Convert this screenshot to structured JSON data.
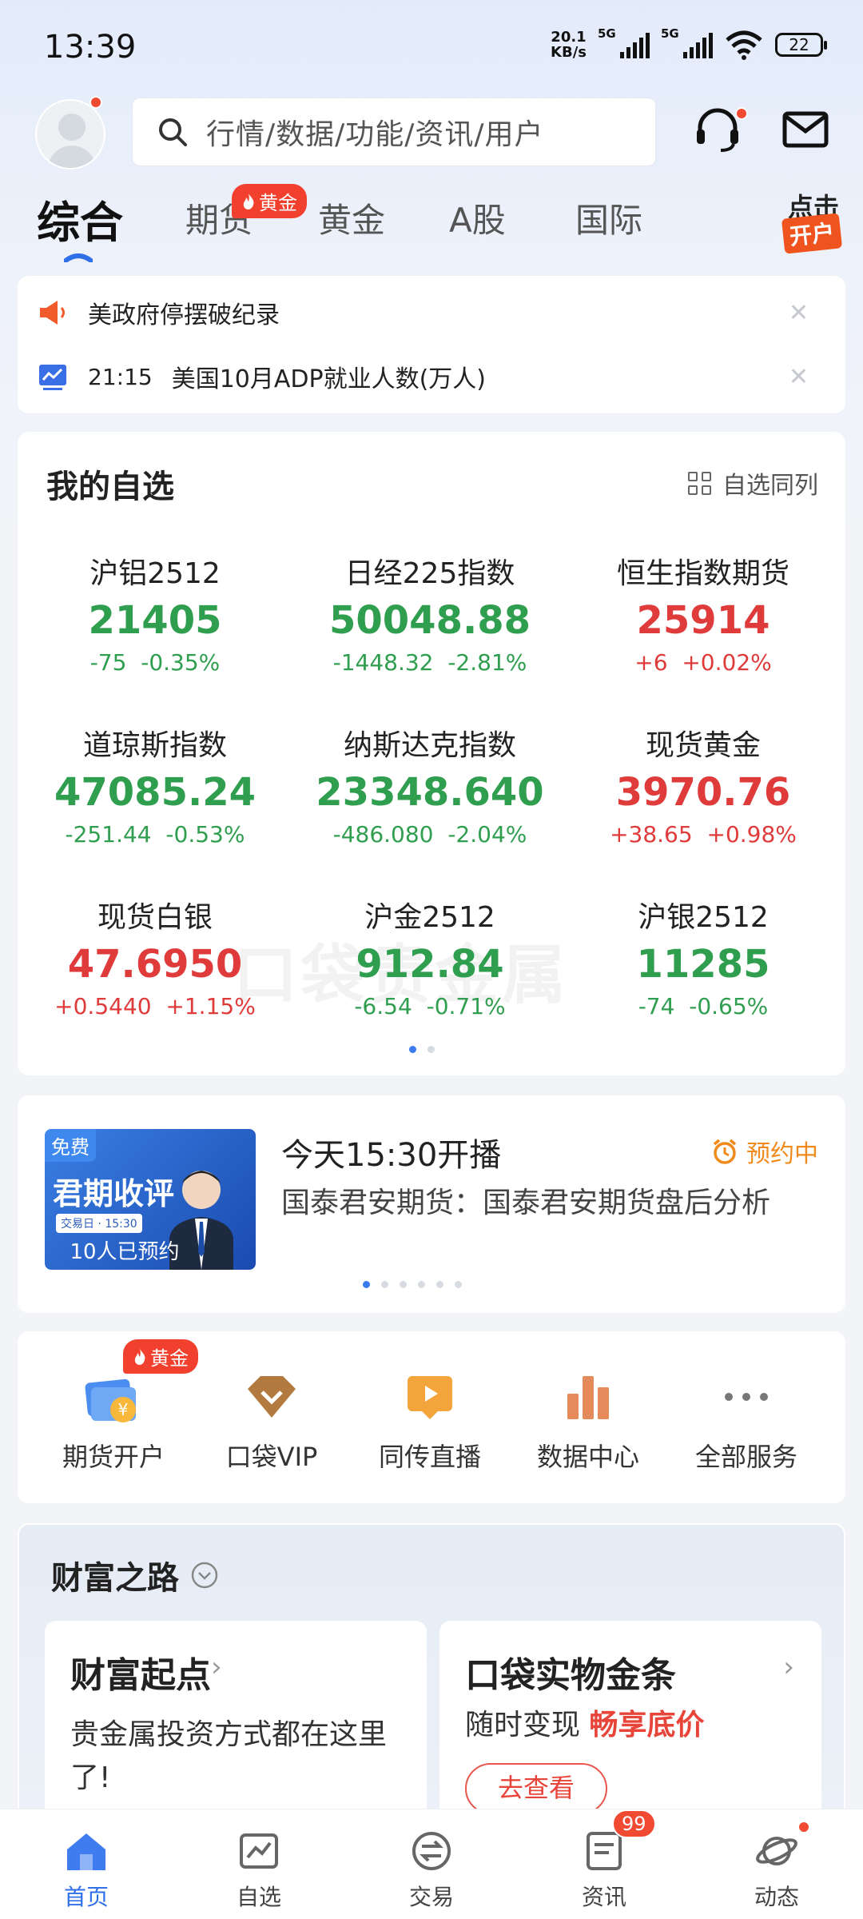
{
  "status_bar": {
    "time": "13:39",
    "net_speed_value": "20.1",
    "net_speed_unit": "KB/s",
    "signal1": "5G",
    "signal2": "5G",
    "battery": "22"
  },
  "header": {
    "search_placeholder": "行情/数据/功能/资讯/用户"
  },
  "tabs": [
    {
      "label": "综合",
      "active": true
    },
    {
      "label": "期货",
      "badge": "黄金"
    },
    {
      "label": "黄金"
    },
    {
      "label": "A股"
    },
    {
      "label": "国际"
    }
  ],
  "promo": {
    "line1": "点击",
    "line2": "开户"
  },
  "notices": [
    {
      "text": "美政府停摆破纪录",
      "icon": "megaphone-icon"
    },
    {
      "time": "21:15",
      "text": "美国10月ADP就业人数(万人)",
      "icon": "chart-icon"
    }
  ],
  "watchlist": {
    "title": "我的自选",
    "link_label": "自选同列",
    "watermark": "口袋贵金属",
    "quotes": [
      {
        "name": "沪铝2512",
        "price": "21405",
        "change": "-75",
        "pct": "-0.35%",
        "dir": "down"
      },
      {
        "name": "日经225指数",
        "price": "50048.88",
        "change": "-1448.32",
        "pct": "-2.81%",
        "dir": "down"
      },
      {
        "name": "恒生指数期货",
        "price": "25914",
        "change": "+6",
        "pct": "+0.02%",
        "dir": "up"
      },
      {
        "name": "道琼斯指数",
        "price": "47085.24",
        "change": "-251.44",
        "pct": "-0.53%",
        "dir": "down"
      },
      {
        "name": "纳斯达克指数",
        "price": "23348.640",
        "change": "-486.080",
        "pct": "-2.04%",
        "dir": "down"
      },
      {
        "name": "现货黄金",
        "price": "3970.76",
        "change": "+38.65",
        "pct": "+0.98%",
        "dir": "up"
      },
      {
        "name": "现货白银",
        "price": "47.6950",
        "change": "+0.5440",
        "pct": "+1.15%",
        "dir": "up"
      },
      {
        "name": "沪金2512",
        "price": "912.84",
        "change": "-6.54",
        "pct": "-0.71%",
        "dir": "down"
      },
      {
        "name": "沪银2512",
        "price": "11285",
        "change": "-74",
        "pct": "-0.65%",
        "dir": "down"
      }
    ]
  },
  "live": {
    "free_tag": "免费",
    "thumb_title": "君期收评",
    "thumb_sub": "交易日 · 15:30",
    "reserved_count": "10人已预约",
    "title": "今天15:30开播",
    "status": "预约中",
    "desc": "国泰君安期货：国泰君安期货盘后分析"
  },
  "services": [
    {
      "label": "期货开户",
      "badge": "黄金",
      "icon": "futures-account-icon"
    },
    {
      "label": "口袋VIP",
      "icon": "vip-diamond-icon"
    },
    {
      "label": "同传直播",
      "icon": "live-play-icon"
    },
    {
      "label": "数据中心",
      "icon": "bar-chart-icon"
    },
    {
      "label": "全部服务",
      "icon": "more-dots-icon"
    }
  ],
  "wealth": {
    "title": "财富之路",
    "card1": {
      "title": "财富起点",
      "desc": "贵金属投资方式都在这里了!"
    },
    "card2": {
      "title": "口袋实物金条",
      "desc_prefix": "随时变现",
      "desc_highlight": "畅享底价",
      "button": "去查看"
    }
  },
  "tabbar": [
    {
      "label": "首页",
      "active": true,
      "icon": "home-icon"
    },
    {
      "label": "自选",
      "icon": "watchlist-icon"
    },
    {
      "label": "交易",
      "icon": "trade-icon"
    },
    {
      "label": "资讯",
      "badge": "99",
      "icon": "news-icon"
    },
    {
      "label": "动态",
      "icon": "planet-icon"
    }
  ],
  "colors": {
    "up": "#e03b3b",
    "down": "#2f9e4f",
    "accent": "#2f6fe8",
    "hot": "#f1402e"
  }
}
